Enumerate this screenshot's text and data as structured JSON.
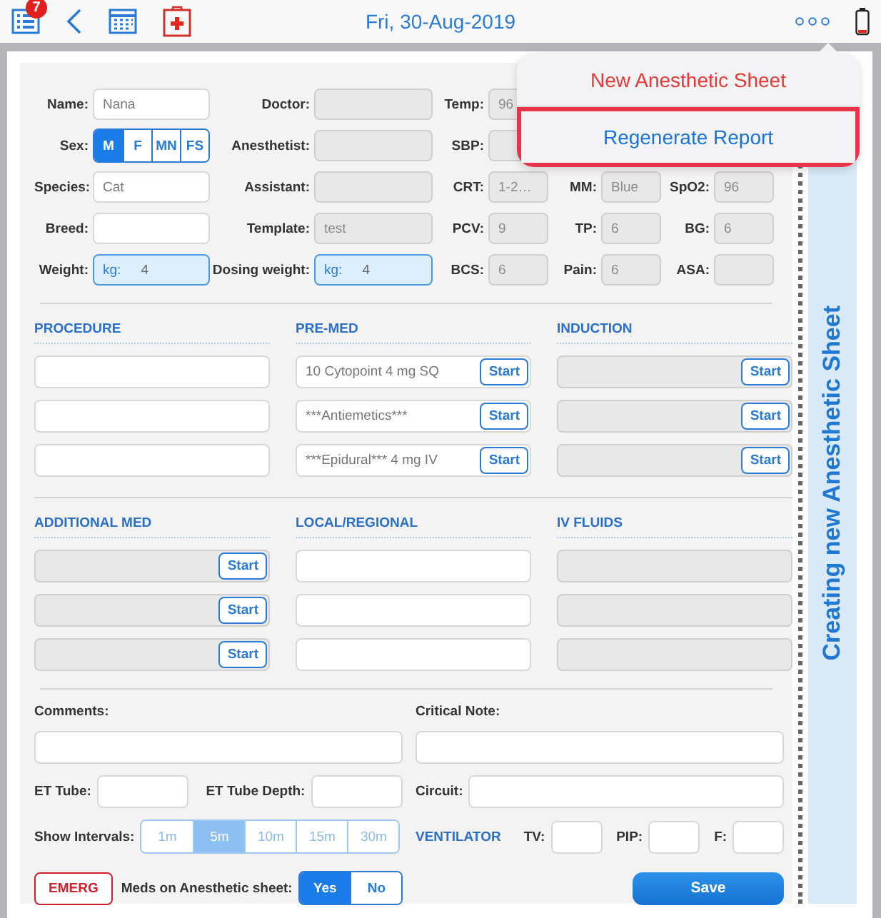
{
  "top_bar": {
    "badge": "7",
    "title": "Fri, 30-Aug-2019"
  },
  "menu": {
    "items": [
      {
        "label": "New Anesthetic Sheet",
        "kind": "destructive",
        "selected": false
      },
      {
        "label": "Regenerate Report",
        "kind": "action",
        "selected": true
      }
    ]
  },
  "patient_fields": [
    {
      "label": "Name:",
      "kind": "text",
      "value": "Nana",
      "disabled": false
    },
    {
      "label": "Sex:",
      "kind": "segmented",
      "options": [
        {
          "label": "M",
          "selected": true
        },
        {
          "label": "F",
          "selected": false
        },
        {
          "label": "MN",
          "selected": false
        },
        {
          "label": "FS",
          "selected": false
        }
      ]
    },
    {
      "label": "Species:",
      "kind": "text",
      "value": "Cat",
      "disabled": false
    },
    {
      "label": "Breed:",
      "kind": "text",
      "disabled": false
    },
    {
      "label": "Weight:",
      "kind": "unit",
      "unit": "kg:",
      "value": "4"
    }
  ],
  "staff_fields": [
    {
      "label": "Doctor:",
      "kind": "text",
      "disabled": true
    },
    {
      "label": "Anesthetist:",
      "kind": "text",
      "disabled": true
    },
    {
      "label": "Assistant:",
      "kind": "text",
      "disabled": true
    },
    {
      "label": "Template:",
      "kind": "text",
      "value": "test",
      "disabled": true
    },
    {
      "label": "Dosing weight:",
      "kind": "unit",
      "unit": "kg:",
      "value": "4"
    }
  ],
  "vitals": [
    {
      "label": "Temp:",
      "value": "96"
    },
    {
      "label": "SBP:"
    },
    {
      "label": "CRT:",
      "value": "1-2…"
    },
    {
      "label": "MM:",
      "value": "Blue"
    },
    {
      "label": "SpO2:",
      "value": "96"
    },
    {
      "label": "PCV:",
      "value": "9"
    },
    {
      "label": "TP:",
      "value": "6"
    },
    {
      "label": "BG:",
      "value": "6"
    },
    {
      "label": "BCS:",
      "value": "6"
    },
    {
      "label": "Pain:",
      "value": "6"
    },
    {
      "label": "ASA:"
    }
  ],
  "sections": [
    {
      "title": "PROCEDURE",
      "rows": [
        {
          "disabled": false
        },
        {
          "disabled": false
        },
        {
          "disabled": false
        }
      ]
    },
    {
      "title": "PRE-MED",
      "rows": [
        {
          "disabled": false,
          "value": "10 Cytopoint 4 mg SQ",
          "button": "Start"
        },
        {
          "disabled": false,
          "value": "***Antiemetics***",
          "button": "Start"
        },
        {
          "disabled": false,
          "value": "***Epidural*** 4 mg IV",
          "button": "Start"
        }
      ]
    },
    {
      "title": "INDUCTION",
      "rows": [
        {
          "disabled": true,
          "button": "Start"
        },
        {
          "disabled": true,
          "button": "Start"
        },
        {
          "disabled": true,
          "button": "Start"
        }
      ]
    },
    {
      "title": "ADDITIONAL MED",
      "rows": [
        {
          "disabled": true,
          "button": "Start"
        },
        {
          "disabled": true,
          "button": "Start"
        },
        {
          "disabled": true,
          "button": "Start"
        }
      ]
    },
    {
      "title": "LOCAL/REGIONAL",
      "rows": [
        {
          "disabled": false
        },
        {
          "disabled": false
        },
        {
          "disabled": false
        }
      ]
    },
    {
      "title": "IV FLUIDS",
      "rows": [
        {
          "disabled": true
        },
        {
          "disabled": true
        },
        {
          "disabled": true
        }
      ]
    }
  ],
  "comments": {
    "label": "Comments:"
  },
  "critical_note": {
    "label": "Critical Note:"
  },
  "et_tube": {
    "label": "ET Tube:"
  },
  "et_tube_depth": {
    "label": "ET Tube Depth:"
  },
  "circuit": {
    "label": "Circuit:"
  },
  "intervals": {
    "label": "Show Intervals:",
    "disabled": true,
    "options": [
      {
        "label": "1m",
        "selected": false
      },
      {
        "label": "5m",
        "selected": true
      },
      {
        "label": "10m",
        "selected": false
      },
      {
        "label": "15m",
        "selected": false
      },
      {
        "label": "30m",
        "selected": false
      }
    ]
  },
  "ventilator": {
    "title": "VENTILATOR",
    "fields": [
      {
        "label": "TV:"
      },
      {
        "label": "PIP:"
      },
      {
        "label": "F:"
      }
    ]
  },
  "emerg_button": "EMERG",
  "meds_on_sheet": {
    "label": "Meds on Anesthetic sheet:",
    "options": [
      {
        "label": "Yes",
        "selected": true
      },
      {
        "label": "No",
        "selected": false
      }
    ]
  },
  "save_button": "Save",
  "side_banner": "Creating new Anesthetic Sheet"
}
